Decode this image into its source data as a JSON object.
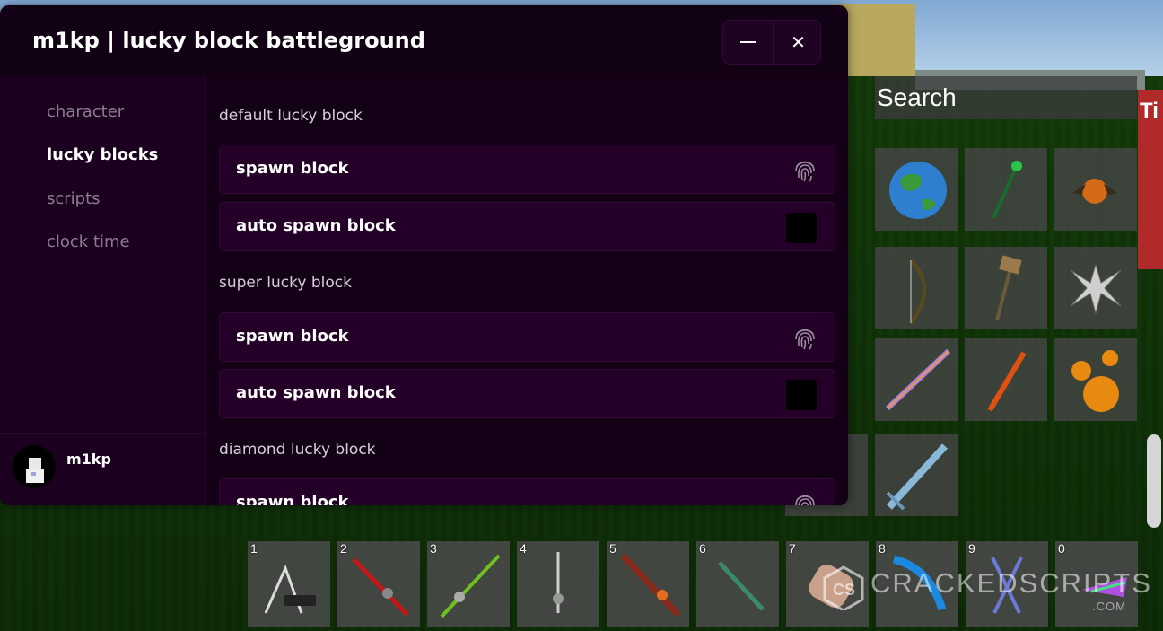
{
  "window": {
    "title": "m1kp | lucky block battleground",
    "minimize_icon": "minus-icon",
    "close_icon": "close-icon",
    "close_glyph": "✕"
  },
  "sidebar": {
    "items": [
      {
        "label": "character",
        "active": false
      },
      {
        "label": "lucky blocks",
        "active": true
      },
      {
        "label": "scripts",
        "active": false
      },
      {
        "label": "clock time",
        "active": false
      }
    ],
    "user": {
      "name": "m1kp"
    }
  },
  "content": {
    "sections": [
      {
        "title": "default lucky block",
        "rows": [
          {
            "label": "spawn block",
            "type": "button",
            "icon": "fingerprint-icon"
          },
          {
            "label": "auto spawn block",
            "type": "toggle",
            "value": false
          }
        ]
      },
      {
        "title": "super lucky block",
        "rows": [
          {
            "label": "spawn block",
            "type": "button",
            "icon": "fingerprint-icon"
          },
          {
            "label": "auto spawn block",
            "type": "toggle",
            "value": false
          }
        ]
      },
      {
        "title": "diamond lucky block",
        "rows": [
          {
            "label": "spawn block",
            "type": "button",
            "icon": "fingerprint-icon"
          }
        ]
      }
    ]
  },
  "inventory": {
    "search_label": "Search",
    "hotbar_numbers": [
      "1",
      "2",
      "3",
      "4",
      "5",
      "6",
      "7",
      "8",
      "9",
      "0"
    ]
  },
  "watermark": {
    "text": "CRACKEDSCRIPTS",
    "sub": ".COM"
  },
  "sign_text": "Ti",
  "colors": {
    "panel_bg": "#16001a",
    "sidebar_bg": "#1c0020",
    "row_bg": "#240029",
    "accent_border": "#34083a",
    "text_primary": "#ffffff",
    "text_muted": "#8a7d8d"
  }
}
